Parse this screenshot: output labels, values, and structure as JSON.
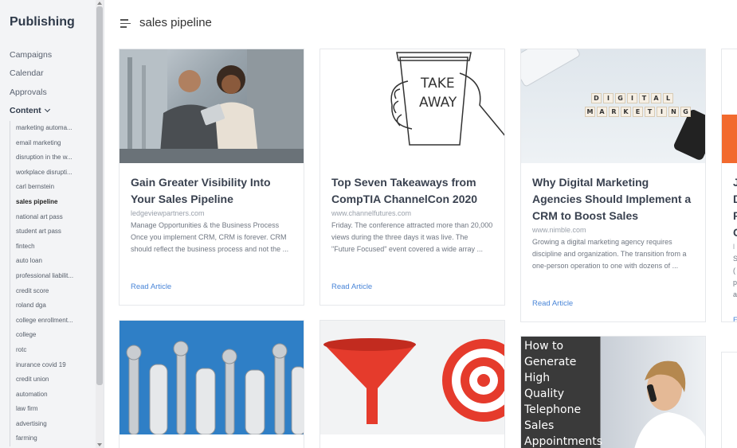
{
  "sidebar": {
    "title": "Publishing",
    "nav": {
      "campaigns": "Campaigns",
      "calendar": "Calendar",
      "approvals": "Approvals",
      "content": "Content"
    },
    "content_items": [
      "marketing automa...",
      "email marketing",
      "disruption in the w...",
      "workplace disrupti...",
      "carl bernstein",
      "sales pipeline",
      "national art pass",
      "student art pass",
      "fintech",
      "auto loan",
      "professional liabilit...",
      "credit score",
      "roland dga",
      "college enrollment...",
      "college",
      "rotc",
      "inurance covid 19",
      "credit union",
      "automation",
      "law firm",
      "advertising",
      "farming"
    ],
    "active_item": "sales pipeline"
  },
  "header": {
    "title": "sales pipeline"
  },
  "cards": [
    {
      "title": "Gain Greater Visibility Into Your Sales Pipeline",
      "source": "ledgeviewpartners.com",
      "excerpt": "Manage Opportunities & the Business Process Once you implement CRM, CRM is forever. CRM should reflect the business process and not the ...",
      "link": "Read Article"
    },
    {
      "title": "Top Seven Takeaways from CompTIA ChannelCon 2020",
      "source": "www.channelfutures.com",
      "excerpt": "Friday. The conference attracted more than 20,000 views during the three days it was live. The \"Future Focused\" event covered a wide array ...",
      "link": "Read Article",
      "image_text": [
        "TAKE",
        "AWAY"
      ]
    },
    {
      "title": "Why Digital Marketing Agencies Should Implement a CRM to Boost Sales",
      "source": "www.nimble.com",
      "excerpt": "Growing a digital marketing agency requires discipline and organization. The transition from a one-person operation to one with dozens of ...",
      "link": "Read Article",
      "image_text": [
        "DIGITAL",
        "MARKETING"
      ]
    },
    {
      "title_fragment": [
        "J",
        "D",
        "F",
        "C"
      ],
      "source_fragment": "l",
      "excerpt_fragment": [
        "S",
        "(",
        "p",
        "a"
      ],
      "link_fragment": "F"
    },
    {
      "image_text": [
        "How to",
        "Generate",
        "High",
        "Quality",
        "Telephone",
        "Sales",
        "Appointments"
      ]
    }
  ],
  "colors": {
    "link": "#4a86d8",
    "sidebar_bg": "#f3f4f6",
    "accent_orange": "#f26a2e"
  }
}
